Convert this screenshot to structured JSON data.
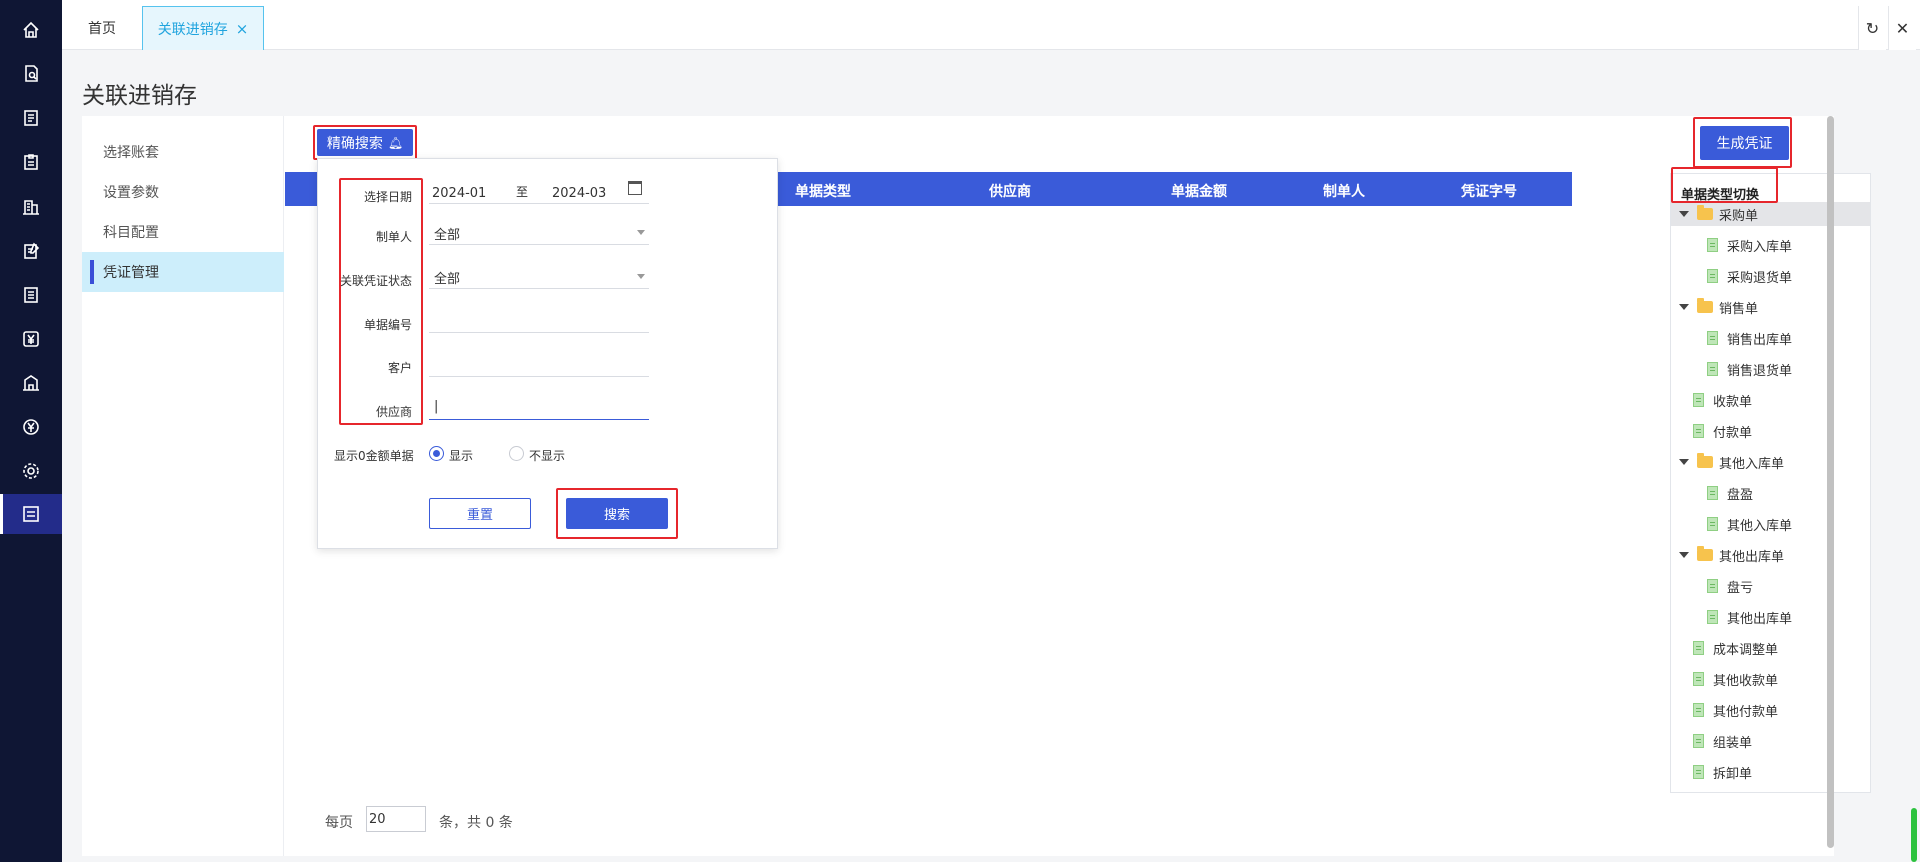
{
  "sidebar_rail": {
    "icons": [
      "home-icon",
      "search-doc-icon",
      "list-icon",
      "clipboard-icon",
      "building-icon",
      "edit-doc-icon",
      "document-icon",
      "yuan-icon",
      "warehouse-icon",
      "yuan-circle-icon",
      "gear-icon",
      "voucher-icon"
    ]
  },
  "tabs": {
    "home": "首页",
    "active": "关联进销存",
    "close": "×"
  },
  "page": {
    "title": "关联进销存"
  },
  "nav": {
    "items": [
      "选择账套",
      "设置参数",
      "科目配置",
      "凭证管理"
    ]
  },
  "toolbar": {
    "precise_search": "精确搜索",
    "generate_voucher": "生成凭证"
  },
  "table": {
    "columns": [
      "单据类型",
      "供应商",
      "单据金额",
      "制单人",
      "凭证字号"
    ]
  },
  "search_form": {
    "date_label": "选择日期",
    "date_from": "2024-01",
    "date_sep": "至",
    "date_to": "2024-03",
    "maker_label": "制单人",
    "maker_value": "全部",
    "status_label": "关联凭证状态",
    "status_value": "全部",
    "bill_no_label": "单据编号",
    "bill_no_value": "",
    "customer_label": "客户",
    "customer_value": "",
    "supplier_label": "供应商",
    "supplier_value": "|",
    "zero_label": "显示0金额单据",
    "zero_show": "显示",
    "zero_hide": "不显示",
    "reset": "重置",
    "search": "搜索"
  },
  "tree": {
    "title": "单据类型切换",
    "nodes": [
      "采购单",
      "采购入库单",
      "采购退货单",
      "销售单",
      "销售出库单",
      "销售退货单",
      "收款单",
      "付款单",
      "其他入库单",
      "盘盈",
      "其他入库单",
      "其他出库单",
      "盘亏",
      "其他出库单",
      "成本调整单",
      "其他收款单",
      "其他付款单",
      "组装单",
      "拆卸单"
    ]
  },
  "pager": {
    "per_page": "每页",
    "size": "20",
    "total": "条，共 0 条"
  },
  "colors": {
    "rail": "#0f1634",
    "primary": "#3a5bd9",
    "tab_active": "#20a4de",
    "highlight": "#e6262c"
  }
}
